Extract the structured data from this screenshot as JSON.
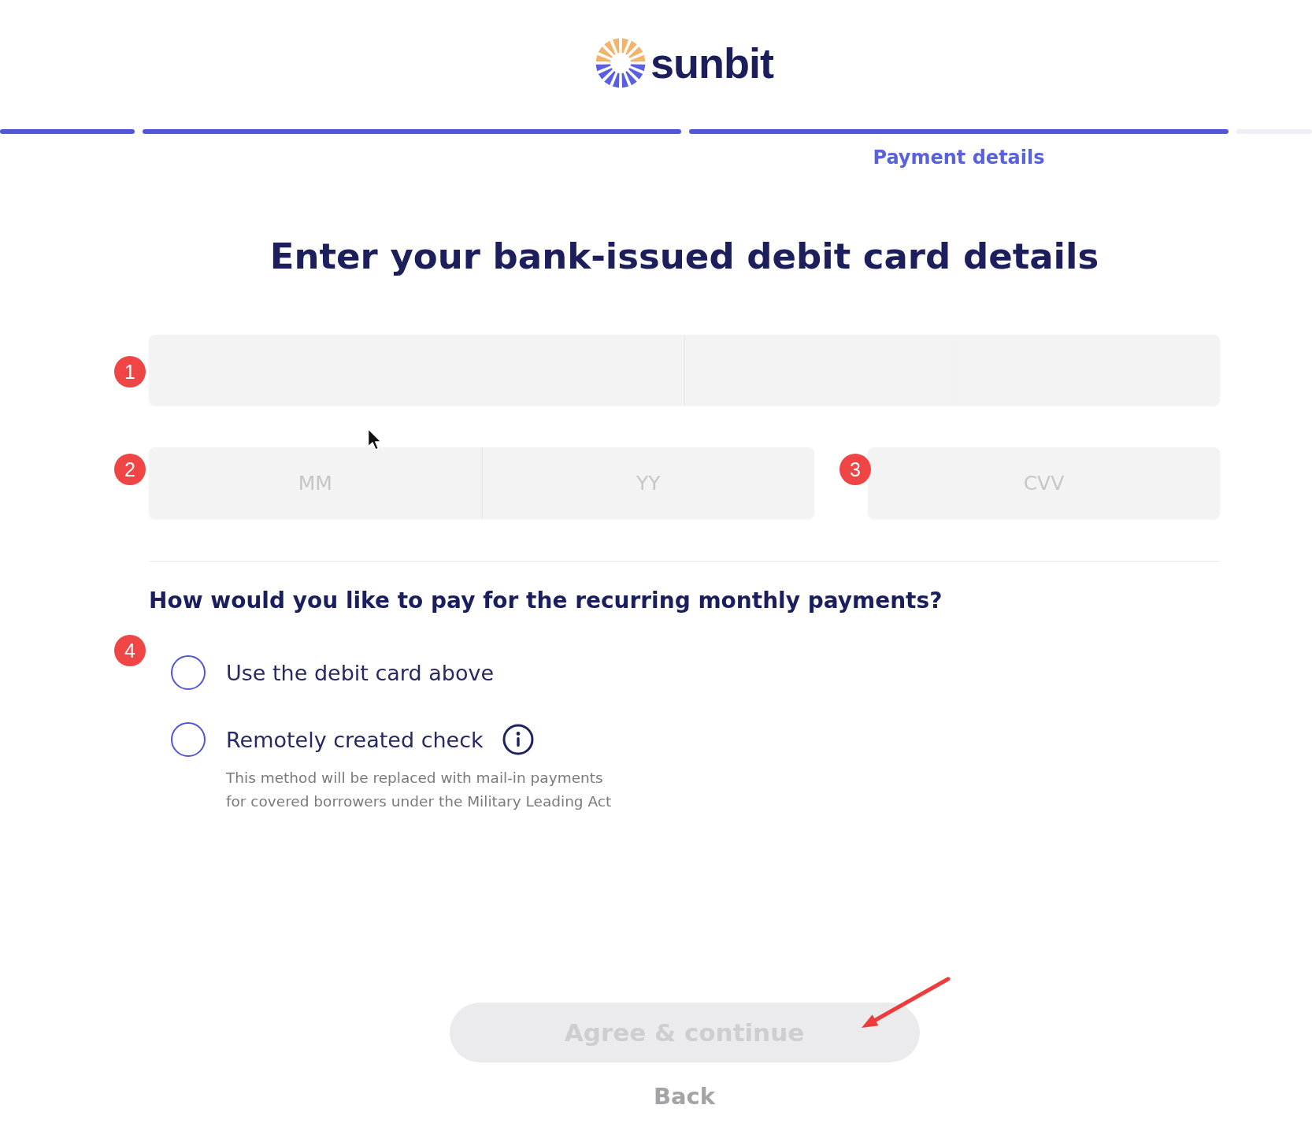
{
  "logo": {
    "wordmark": "sunbit"
  },
  "progress": {
    "steps": [
      {
        "done": true
      },
      {
        "done": true
      },
      {
        "done": true,
        "label": "Payment details"
      },
      {
        "done": false
      }
    ]
  },
  "heading": "Enter your bank-issued debit card details",
  "card_number": {
    "badge": "1"
  },
  "expiry": {
    "badge": "2",
    "parts": [
      {
        "placeholder": "MM"
      },
      {
        "placeholder": "YY"
      }
    ]
  },
  "cvv": {
    "badge": "3",
    "placeholder": "CVV"
  },
  "recurring_payment": {
    "question": "How would you like to pay for the recurring monthly payments?",
    "badge": "4",
    "options": [
      {
        "label": "Use the debit card above",
        "selected": false
      },
      {
        "label": "Remotely created check",
        "selected": false,
        "info": true,
        "note": "This method will be replaced with mail-in payments for covered borrowers under the Military Leading Act"
      }
    ]
  },
  "primary_button": {
    "label": "Agree & continue",
    "disabled": true
  },
  "back_link": {
    "label": "Back"
  }
}
